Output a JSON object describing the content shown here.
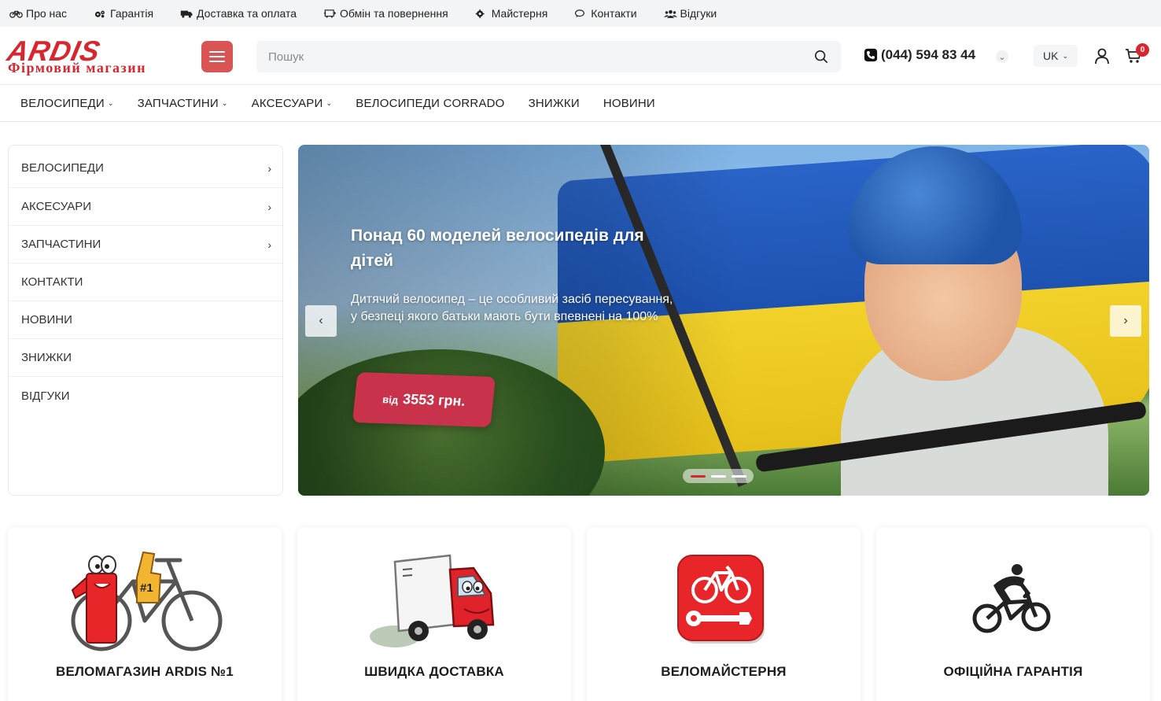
{
  "topbar": {
    "links": [
      {
        "label": "Про нас",
        "icon": "bicycle-icon"
      },
      {
        "label": "Гарантія",
        "icon": "gears-icon"
      },
      {
        "label": "Доставка та оплата",
        "icon": "truck-icon"
      },
      {
        "label": "Обмін та повернення",
        "icon": "exchange-icon"
      },
      {
        "label": "Майстерня",
        "icon": "gear-icon"
      },
      {
        "label": "Контакти",
        "icon": "chat-icon"
      },
      {
        "label": "Відгуки",
        "icon": "users-icon"
      }
    ]
  },
  "header": {
    "logo_main": "ARDIS",
    "logo_sub": "Фірмовий магазин",
    "search_placeholder": "Пошук",
    "phone": "(044) 594 83 44",
    "language": "UK",
    "cart_count": "0",
    "accent_color": "#d8262f",
    "burger_color": "#d85455"
  },
  "mainnav": {
    "items": [
      {
        "label": "ВЕЛОСИПЕДИ",
        "has_dropdown": true
      },
      {
        "label": "ЗАПЧАСТИНИ",
        "has_dropdown": true
      },
      {
        "label": "АКСЕСУАРИ",
        "has_dropdown": true
      },
      {
        "label": "ВЕЛОСИПЕДИ CORRADO",
        "has_dropdown": false
      },
      {
        "label": "ЗНИЖКИ",
        "has_dropdown": false
      },
      {
        "label": "НОВИНИ",
        "has_dropdown": false
      }
    ]
  },
  "sidebar": {
    "items": [
      {
        "label": "ВЕЛОСИПЕДИ",
        "has_arrow": true
      },
      {
        "label": "АКСЕСУАРИ",
        "has_arrow": true
      },
      {
        "label": "ЗАПЧАСТИНИ",
        "has_arrow": true
      },
      {
        "label": "КОНТАКТИ",
        "has_arrow": false
      },
      {
        "label": "НОВИНИ",
        "has_arrow": false
      },
      {
        "label": "ЗНИЖКИ",
        "has_arrow": false
      },
      {
        "label": "ВІДГУКИ",
        "has_arrow": false
      }
    ]
  },
  "hero": {
    "title": "Понад 60 моделей велосипедів для дітей",
    "description": "Дитячий велосипед – це особливий засіб пересування, у безпеці якого батьки мають бути впевнені на 100%",
    "price_prefix": "від",
    "price_value": "3553 грн.",
    "price_color": "#c9324b",
    "prev_arrow": "‹",
    "next_arrow": "›",
    "slides_count": 3,
    "active_slide": 1
  },
  "features": {
    "items": [
      {
        "label": "ВЕЛОМАГАЗИН ARDIS №1",
        "icon": "bike-number-one-icon"
      },
      {
        "label": "ШВИДКА ДОСТАВКА",
        "icon": "delivery-truck-icon"
      },
      {
        "label": "ВЕЛОМАЙСТЕРНЯ",
        "icon": "bike-repair-icon"
      },
      {
        "label": "ОФІЦІЙНА ГАРАНТІЯ",
        "icon": "bmx-rider-icon"
      }
    ]
  }
}
